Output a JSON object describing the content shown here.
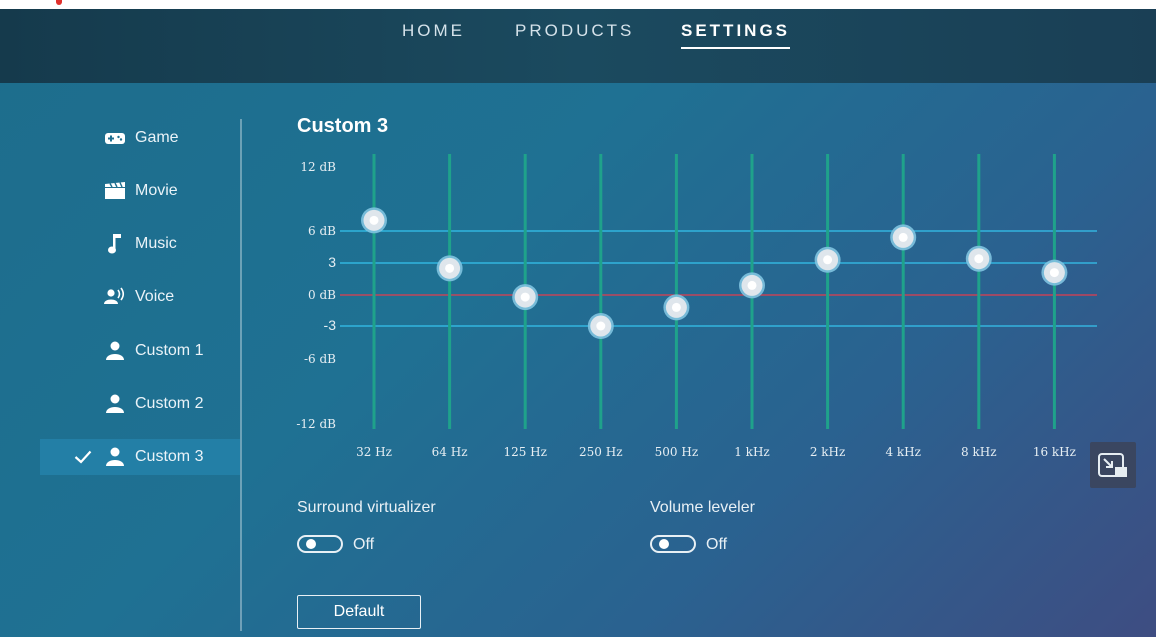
{
  "nav": {
    "items": [
      "HOME",
      "PRODUCTS",
      "SETTINGS"
    ],
    "active": "SETTINGS"
  },
  "sidebar": {
    "items": [
      {
        "label": "Game",
        "icon": "gamepad-icon"
      },
      {
        "label": "Movie",
        "icon": "clapperboard-icon"
      },
      {
        "label": "Music",
        "icon": "music-note-icon"
      },
      {
        "label": "Voice",
        "icon": "voice-icon"
      },
      {
        "label": "Custom 1",
        "icon": "person-icon"
      },
      {
        "label": "Custom 2",
        "icon": "person-icon"
      },
      {
        "label": "Custom 3",
        "icon": "person-icon"
      }
    ],
    "selected": "Custom 3"
  },
  "panel": {
    "title": "Custom 3"
  },
  "equalizer": {
    "y_ticks": [
      "12 dB",
      "6 dB",
      "3",
      "0 dB",
      "-3",
      "-6 dB",
      "-12 dB"
    ],
    "bands": [
      {
        "label": "32 Hz",
        "gain_db": 7
      },
      {
        "label": "64 Hz",
        "gain_db": 2.5
      },
      {
        "label": "125 Hz",
        "gain_db": -0.2
      },
      {
        "label": "250 Hz",
        "gain_db": -3
      },
      {
        "label": "500 Hz",
        "gain_db": -1.2
      },
      {
        "label": "1 kHz",
        "gain_db": 0.9
      },
      {
        "label": "2 kHz",
        "gain_db": 3.3
      },
      {
        "label": "4 kHz",
        "gain_db": 5.4
      },
      {
        "label": "8 kHz",
        "gain_db": 3.4
      },
      {
        "label": "16 kHz",
        "gain_db": 2.1
      }
    ],
    "colors": {
      "rail": "#1fa28b",
      "guide": "#35c4ee",
      "zero": "#e23d4e",
      "knob": "#dfe6ec"
    }
  },
  "options": {
    "surround": {
      "label": "Surround virtualizer",
      "state": "Off"
    },
    "leveler": {
      "label": "Volume leveler",
      "state": "Off"
    }
  },
  "buttons": {
    "default_label": "Default"
  },
  "zoom_icon": "fit-screen-icon"
}
